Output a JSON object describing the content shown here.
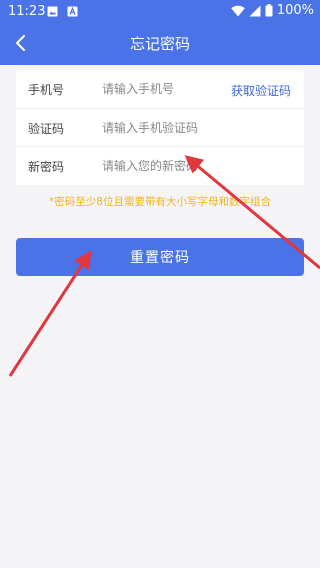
{
  "status_bar": {
    "time": "11:23",
    "battery": "100%",
    "icons": [
      "image-icon",
      "text-a-icon",
      "wifi-icon",
      "signal-icon",
      "battery-icon"
    ]
  },
  "header": {
    "title": "忘记密码",
    "back_icon": "chevron-left-icon"
  },
  "form": {
    "phone": {
      "label": "手机号",
      "placeholder": "请输入手机号",
      "action": "获取验证码"
    },
    "code": {
      "label": "验证码",
      "placeholder": "请输入手机验证码"
    },
    "new_password": {
      "label": "新密码",
      "placeholder": "请输入您的新密码"
    }
  },
  "hint": "*密码至少8位且需要带有大小写字母和数字组合",
  "reset_button": "重置密码",
  "colors": {
    "primary": "#4a73e8",
    "link": "#3d67e0",
    "hint": "#f2b21c",
    "annotation_arrow": "#e0383e",
    "background": "#f5f5f7"
  }
}
